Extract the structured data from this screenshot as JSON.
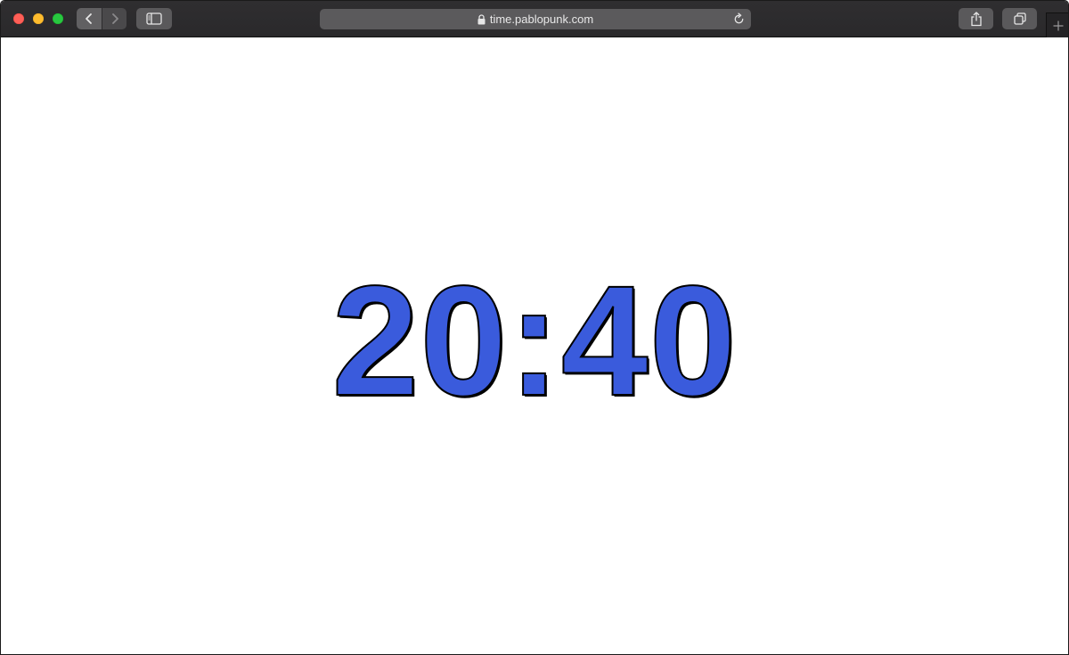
{
  "browser": {
    "url": "time.pablopunk.com",
    "icons": {
      "close": "close-traffic-light",
      "minimize": "minimize-traffic-light",
      "zoom": "zoom-traffic-light",
      "back": "chevron-left-icon",
      "forward": "chevron-right-icon",
      "sidebar": "sidebar-icon",
      "lock": "lock-icon",
      "reload": "reload-icon",
      "share": "share-icon",
      "tabs": "tabs-overview-icon",
      "new_tab": "plus-icon"
    },
    "colors": {
      "toolbar": "#2c2b2d",
      "traffic_close": "#fe5f57",
      "traffic_minimize": "#febc2e",
      "traffic_zoom": "#28c840"
    }
  },
  "page": {
    "time": "20:40",
    "colors": {
      "background": "#ffffff",
      "time_fill": "#3a5bdc",
      "time_outline": "#000000"
    }
  }
}
